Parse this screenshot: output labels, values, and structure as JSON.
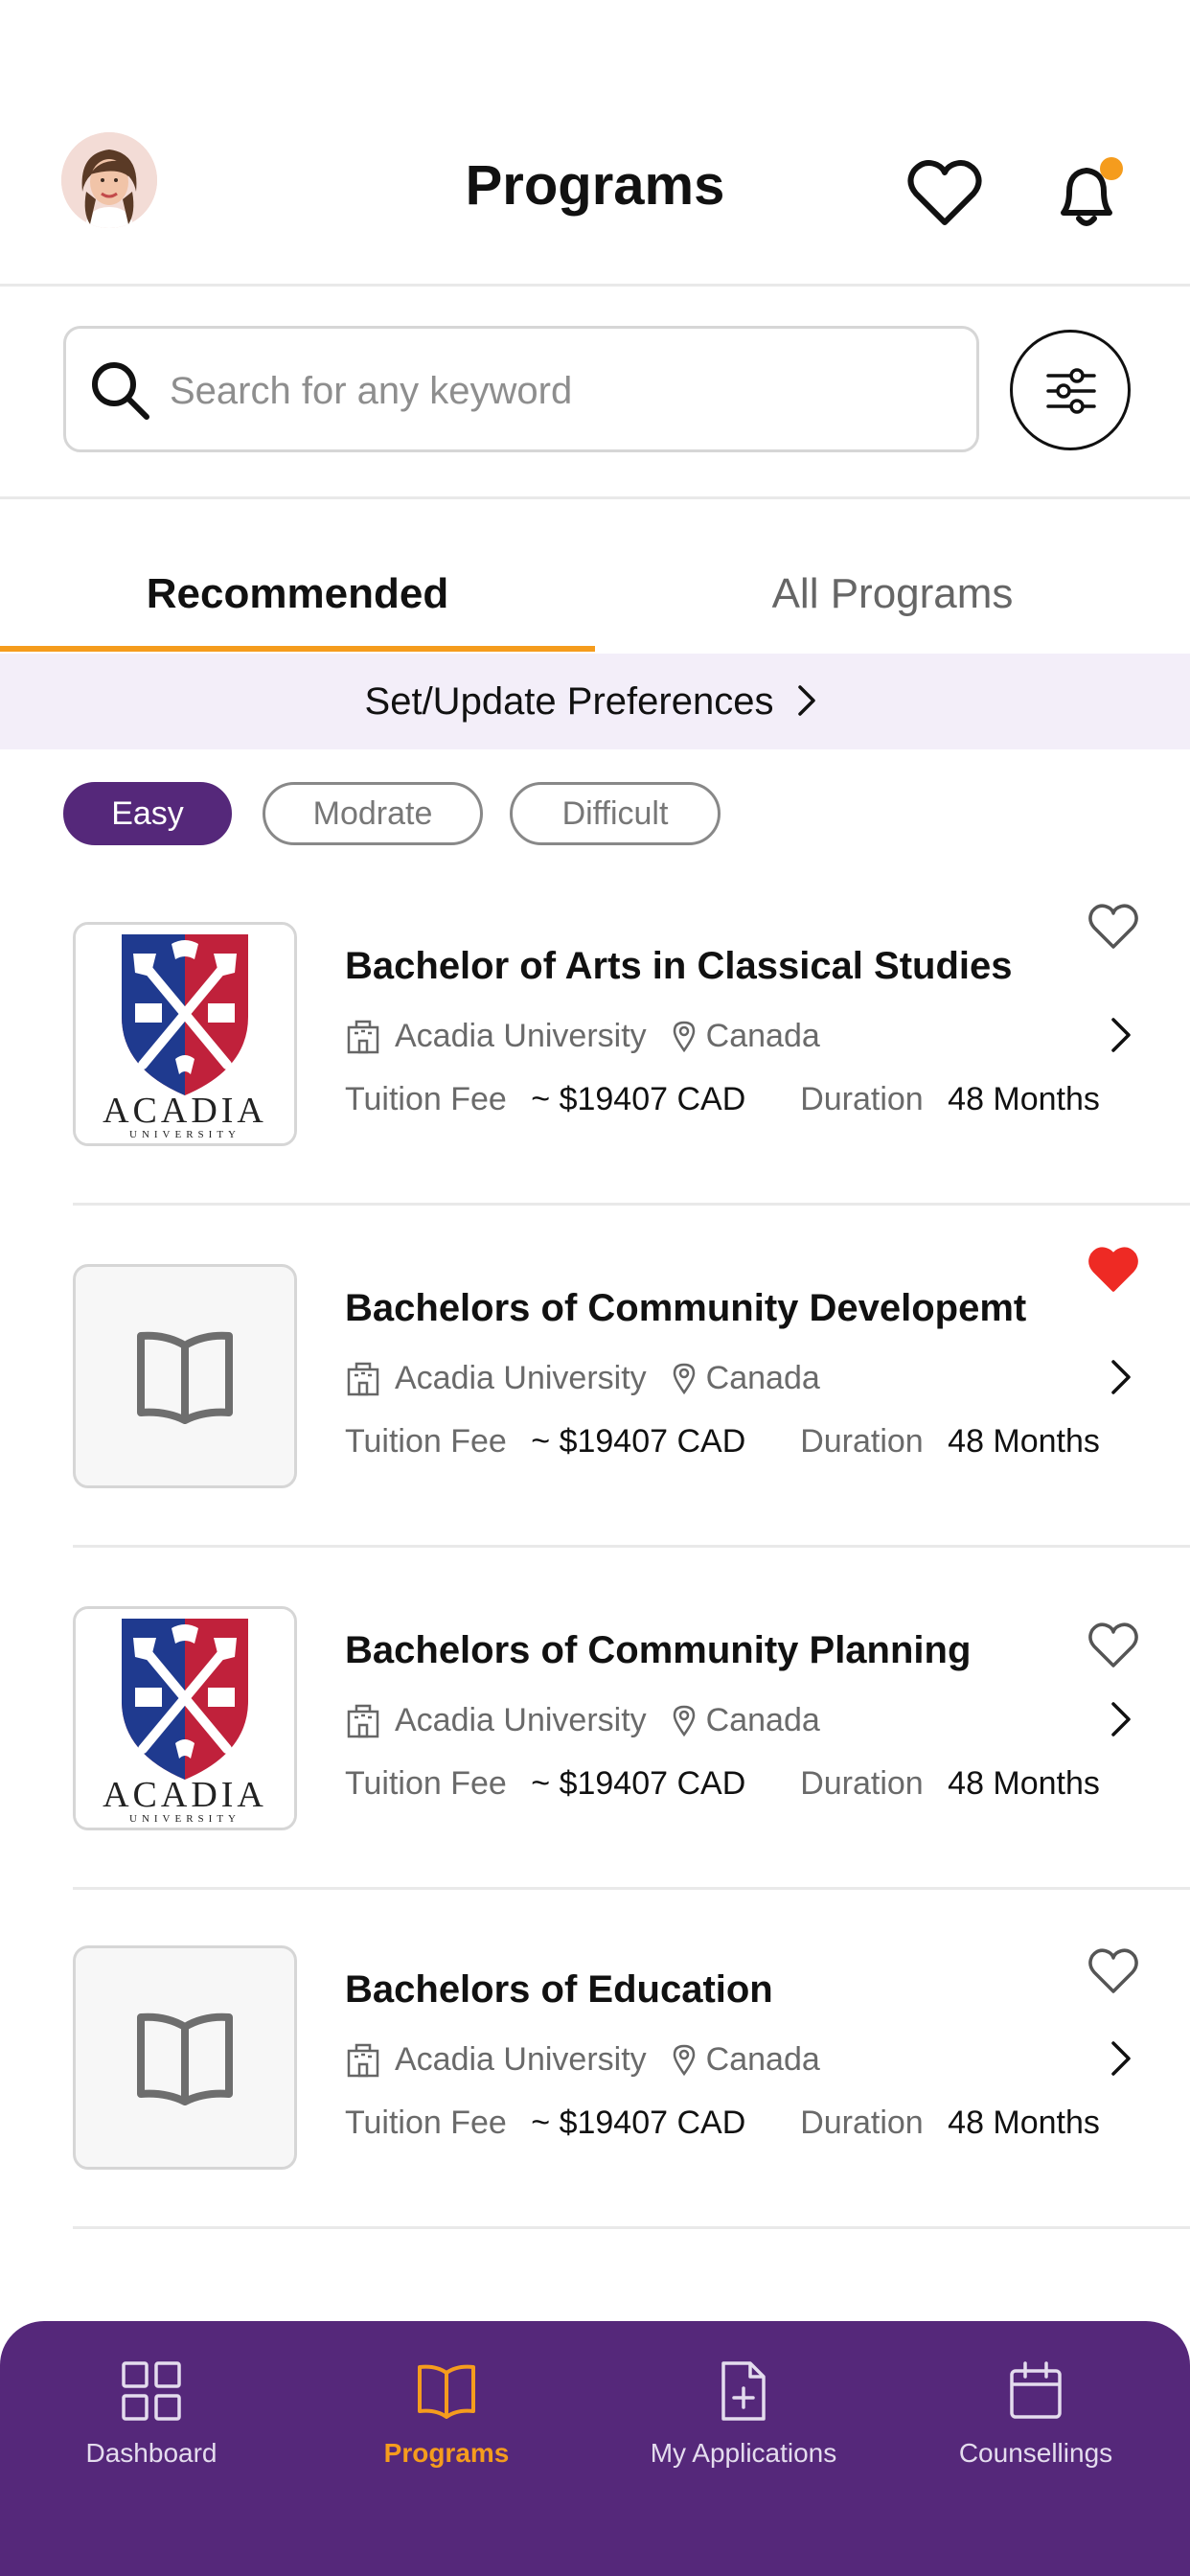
{
  "header": {
    "title": "Programs"
  },
  "search": {
    "placeholder": "Search for any keyword",
    "value": ""
  },
  "tabs": [
    {
      "label": "Recommended",
      "active": true
    },
    {
      "label": "All Programs",
      "active": false
    }
  ],
  "preferences": {
    "label": "Set/Update Preferences"
  },
  "difficulty_filters": [
    {
      "label": "Easy",
      "selected": true
    },
    {
      "label": "Modrate",
      "selected": false
    },
    {
      "label": "Difficult",
      "selected": false
    }
  ],
  "programs": [
    {
      "title": "Bachelor of Arts in Classical Studies",
      "university": "Acadia University",
      "country": "Canada",
      "fee_label": "Tuition Fee",
      "fee": "~ $19407 CAD",
      "duration_label": "Duration",
      "duration": "48 Months",
      "logo": "acadia-logo",
      "favorite": false
    },
    {
      "title": "Bachelors of Community Developemt",
      "university": "Acadia University",
      "country": "Canada",
      "fee_label": "Tuition Fee",
      "fee": "~ $19407 CAD",
      "duration_label": "Duration",
      "duration": "48 Months",
      "logo": "book-icon",
      "favorite": true
    },
    {
      "title": "Bachelors of Community Planning",
      "university": "Acadia University",
      "country": "Canada",
      "fee_label": "Tuition Fee",
      "fee": "~ $19407 CAD",
      "duration_label": "Duration",
      "duration": "48 Months",
      "logo": "acadia-logo",
      "favorite": false
    },
    {
      "title": "Bachelors of Education",
      "university": "Acadia University",
      "country": "Canada",
      "fee_label": "Tuition Fee",
      "fee": "~ $19407 CAD",
      "duration_label": "Duration",
      "duration": "48 Months",
      "logo": "book-icon",
      "favorite": false
    }
  ],
  "logo_text": {
    "name": "ACADIA",
    "sub": "UNIVERSITY"
  },
  "bottom_nav": [
    {
      "label": "Dashboard",
      "icon": "grid-icon",
      "active": false
    },
    {
      "label": "Programs",
      "icon": "book-open-icon",
      "active": true
    },
    {
      "label": "My Applications",
      "icon": "file-plus-icon",
      "active": false
    },
    {
      "label": "Counsellings",
      "icon": "calendar-icon",
      "active": false
    }
  ],
  "colors": {
    "accent": "#f59c1d",
    "brand_purple": "#55287a",
    "preferences_bg": "#f3eef9",
    "favorite_red": "#ee2a24",
    "notification_dot": "#f59c1d",
    "acadia_blue": "#1f3a8f",
    "acadia_red": "#c0213b"
  }
}
